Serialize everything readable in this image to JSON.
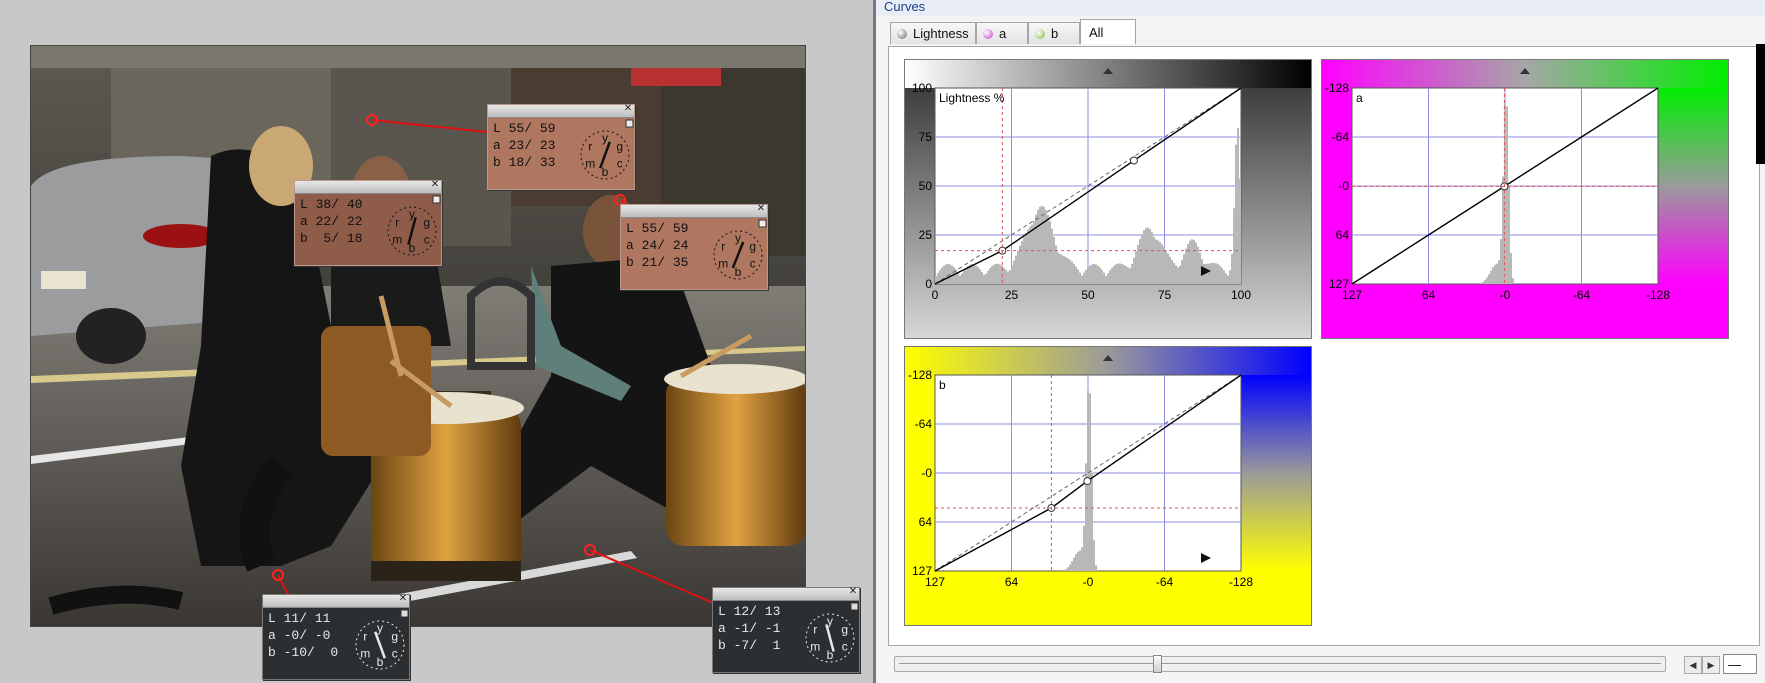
{
  "window_title": "Curves",
  "tabs": [
    {
      "label": "Lightness",
      "active": false,
      "icon": "lightness-channel-icon",
      "color": "#888888"
    },
    {
      "label": "a",
      "active": false,
      "icon": "a-channel-icon",
      "color": "#c23dc2"
    },
    {
      "label": "b",
      "active": false,
      "icon": "b-channel-icon",
      "color": "#7ab83e"
    },
    {
      "label": "All",
      "active": true
    }
  ],
  "probes": [
    {
      "L": "55/ 59",
      "a": "23/ 23",
      "b": "18/ 33",
      "style": "tan",
      "dial_angle": 20
    },
    {
      "L": "38/ 40",
      "a": "22/ 22",
      "b": " 5/ 18",
      "style": "brown",
      "dial_angle": 15
    },
    {
      "L": "55/ 59",
      "a": "24/ 24",
      "b": "21/ 35",
      "style": "tan",
      "dial_angle": 22
    },
    {
      "L": "11/ 11",
      "a": "-0/ -0",
      "b": "-10/  0",
      "style": "dark",
      "dial_angle": 160
    },
    {
      "L": "12/ 13",
      "a": "-1/ -1",
      "b": "-7/  1",
      "style": "dark",
      "dial_angle": 165
    }
  ],
  "dial_letters": [
    "r",
    "y",
    "g",
    "c",
    "b",
    "m"
  ],
  "curves": {
    "lightness": {
      "label": "Lightness %",
      "y_ticks": [
        "100",
        "75",
        "50",
        "25",
        "0"
      ],
      "x_ticks": [
        "0",
        "25",
        "50",
        "75",
        "100"
      ],
      "control_points": [
        [
          0,
          0
        ],
        [
          22,
          17
        ],
        [
          65,
          63
        ],
        [
          100,
          100
        ]
      ],
      "xlim": [
        0,
        100
      ],
      "ylim": [
        0,
        100
      ]
    },
    "a": {
      "label": "a",
      "y_ticks": [
        "-128",
        "-64",
        "-0",
        "64",
        "127"
      ],
      "x_ticks": [
        "127",
        "64",
        "-0",
        "-64",
        "-128"
      ],
      "control_points": [
        [
          127,
          127
        ],
        [
          0,
          0
        ],
        [
          -128,
          -128
        ]
      ]
    },
    "b": {
      "label": "b",
      "y_ticks": [
        "-128",
        "-64",
        "-0",
        "64",
        "127"
      ],
      "x_ticks": [
        "127",
        "64",
        "-0",
        "-64",
        "-128"
      ],
      "control_points": [
        [
          127,
          127
        ],
        [
          30,
          45
        ],
        [
          0,
          10
        ],
        [
          -128,
          -128
        ]
      ]
    }
  },
  "bottom": {
    "value": "—"
  },
  "colors": {
    "magenta": "#ff00ff",
    "green": "#00ee00",
    "yellow": "#ffff00",
    "blue": "#0000ff",
    "grid": "#8e8ee6"
  }
}
